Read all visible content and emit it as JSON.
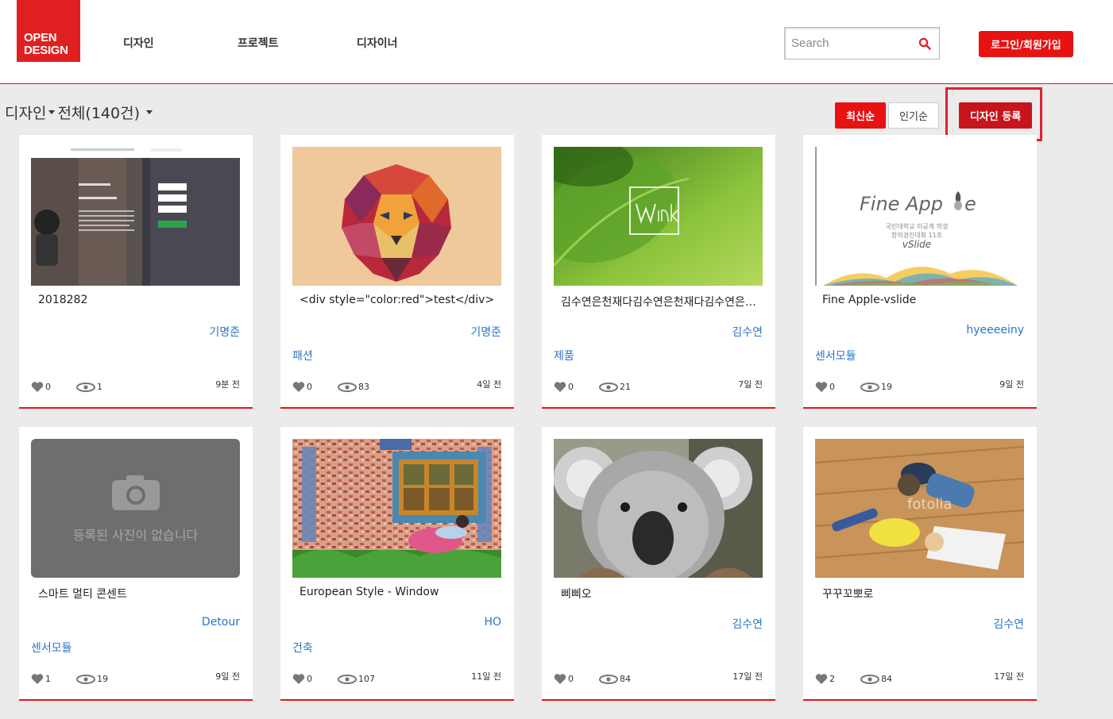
{
  "logo": {
    "line1": "OPEN",
    "line2": "DESIGN"
  },
  "nav": [
    "디자인",
    "프로젝트",
    "디자이너"
  ],
  "search": {
    "placeholder": "Search"
  },
  "login_label": "로그인/회원가입",
  "breadcrumb": {
    "section": "디자인",
    "filter": "전체(140건)"
  },
  "sort": {
    "newest": "최신순",
    "popular": "인기순"
  },
  "register_label": "디자인 등록",
  "no_image_text": "등록된 사진이 없습니다",
  "cards": [
    {
      "title": "2018282",
      "author": "기명준",
      "category": "",
      "likes": "0",
      "views": "1",
      "time": "9분 전",
      "thumb": "github-screenshot"
    },
    {
      "title": "<div style=\"color:red\">test</div>",
      "author": "기명준",
      "category": "패션",
      "likes": "0",
      "views": "83",
      "time": "4일 전",
      "thumb": "geometric-lion"
    },
    {
      "title": "김수연은천재다김수연은천재다김수연은천재다",
      "author": "김수연",
      "category": "제품",
      "likes": "0",
      "views": "21",
      "time": "7일 전",
      "thumb": "green-leaf"
    },
    {
      "title": "Fine Apple-vslide",
      "author": "hyeeeeiny",
      "category": "센서모듈",
      "likes": "0",
      "views": "19",
      "time": "9일 전",
      "thumb": "fine-apple-slide",
      "thumb_text": {
        "title": "Fine App",
        "title_end": "e",
        "sub1": "국민대학교 이공계 학생",
        "sub2": "창의경진대회 11조",
        "sub3": "vSlide"
      }
    },
    {
      "title": "스마트 멀티 콘센트",
      "author": "Detour",
      "category": "센서모듈",
      "likes": "1",
      "views": "19",
      "time": "9일 전",
      "thumb": "no-image"
    },
    {
      "title": "European Style - Window",
      "author": "HO",
      "category": "건축",
      "likes": "0",
      "views": "107",
      "time": "11일 전",
      "thumb": "european-window"
    },
    {
      "title": "삐삐오",
      "author": "김수연",
      "category": "",
      "likes": "0",
      "views": "84",
      "time": "17일 전",
      "thumb": "koala"
    },
    {
      "title": "꾸꾸꼬뽀로",
      "author": "김수연",
      "category": "",
      "likes": "2",
      "views": "84",
      "time": "17일 전",
      "thumb": "kids-drawing",
      "thumb_text": {
        "watermark": "fotolia"
      }
    }
  ],
  "colors": {
    "brand": "#e02020",
    "link": "#2a74c8"
  }
}
